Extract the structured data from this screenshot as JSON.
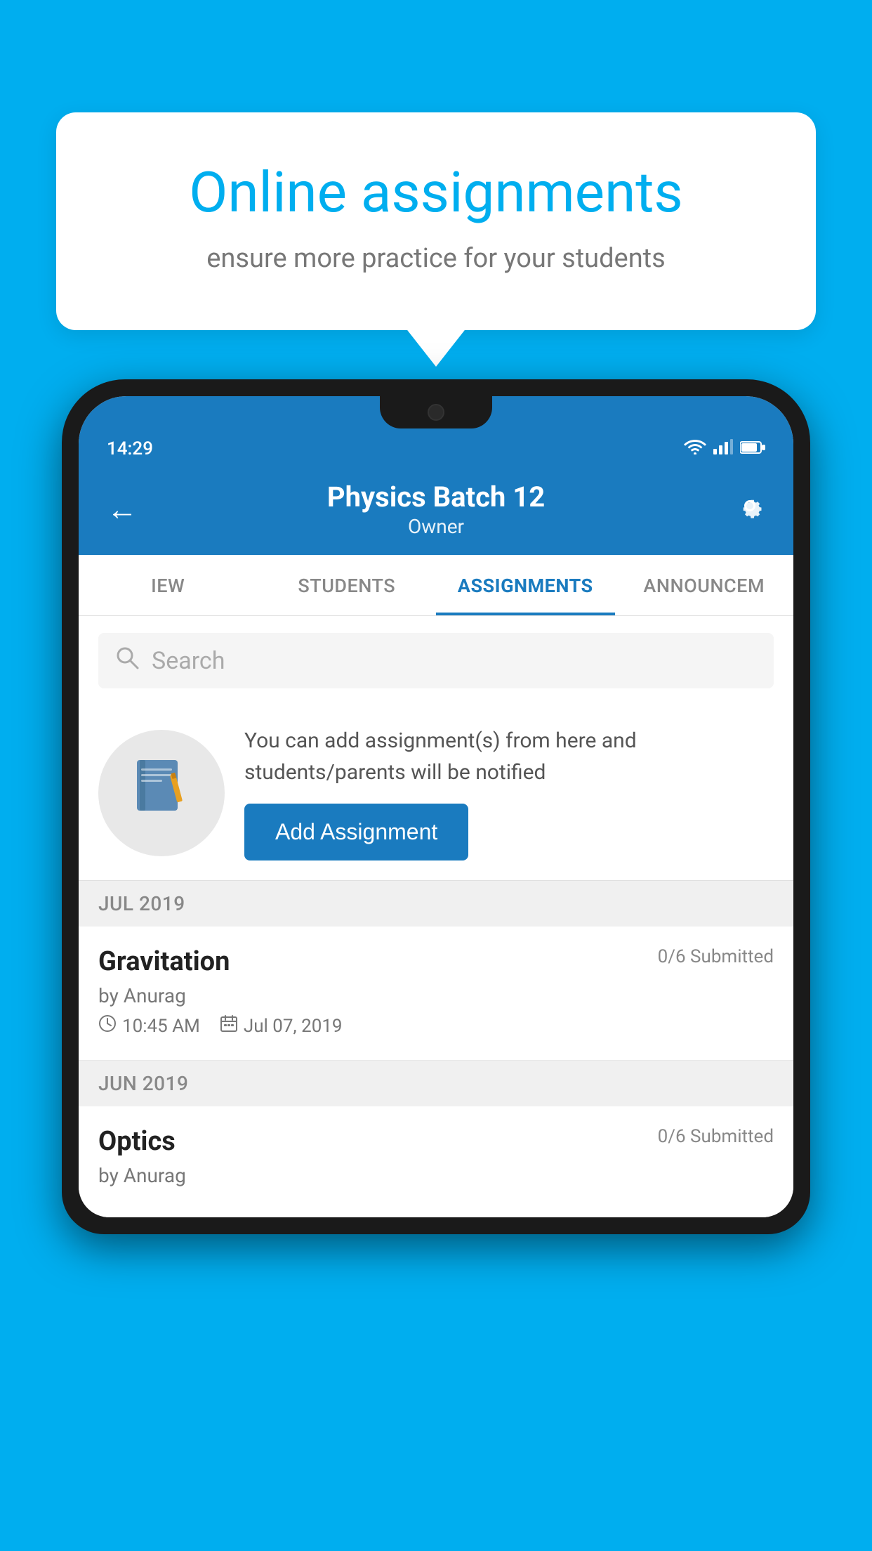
{
  "background_color": "#00AEEF",
  "tooltip": {
    "title": "Online assignments",
    "subtitle": "ensure more practice for your students"
  },
  "status_bar": {
    "time": "14:29",
    "icons": [
      "wifi",
      "signal",
      "battery"
    ]
  },
  "header": {
    "title": "Physics Batch 12",
    "subtitle": "Owner",
    "back_label": "←",
    "settings_label": "⚙"
  },
  "tabs": [
    {
      "label": "IEW",
      "active": false
    },
    {
      "label": "STUDENTS",
      "active": false
    },
    {
      "label": "ASSIGNMENTS",
      "active": true
    },
    {
      "label": "ANNOUNCEM",
      "active": false
    }
  ],
  "search": {
    "placeholder": "Search"
  },
  "promo": {
    "description": "You can add assignment(s) from here and students/parents will be notified",
    "button_label": "Add Assignment"
  },
  "sections": [
    {
      "month": "JUL 2019",
      "assignments": [
        {
          "name": "Gravitation",
          "submitted": "0/6 Submitted",
          "author": "by Anurag",
          "time": "10:45 AM",
          "date": "Jul 07, 2019"
        }
      ]
    },
    {
      "month": "JUN 2019",
      "assignments": [
        {
          "name": "Optics",
          "submitted": "0/6 Submitted",
          "author": "by Anurag",
          "time": "",
          "date": ""
        }
      ]
    }
  ]
}
